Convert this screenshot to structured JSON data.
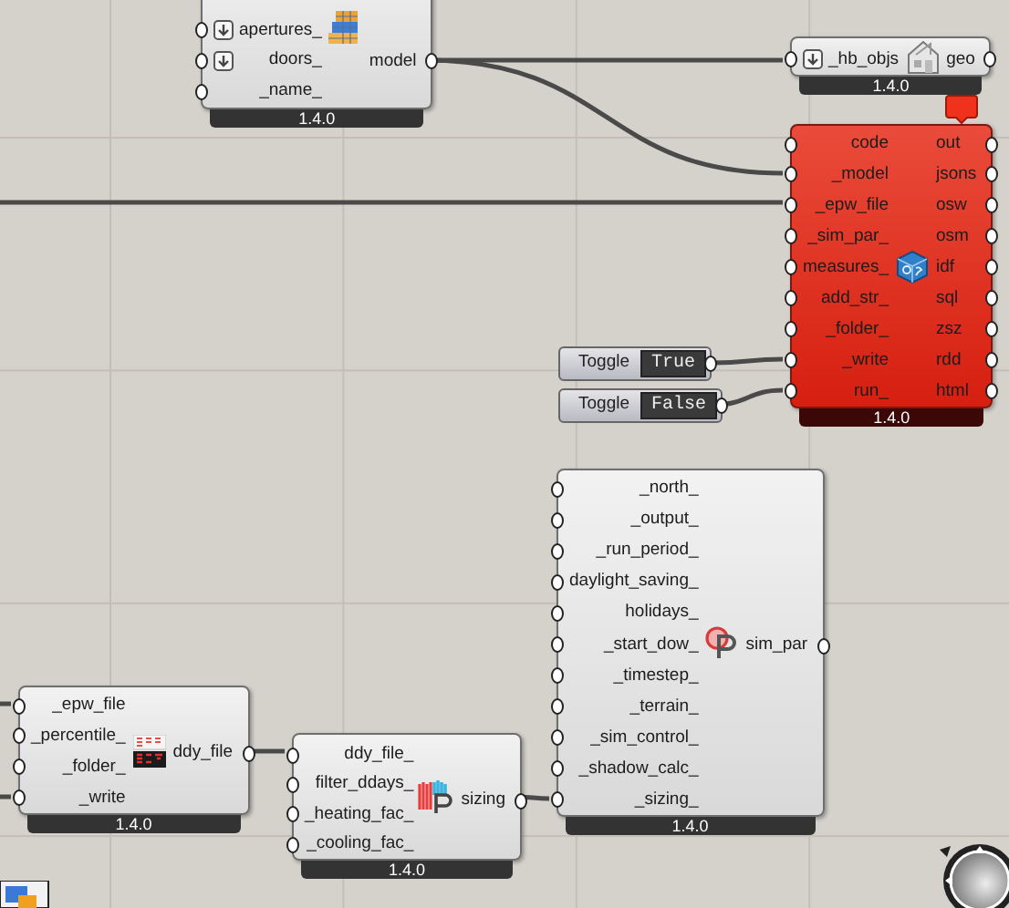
{
  "components": [
    {
      "kind": "model",
      "error": false,
      "inputs": [
        {
          "label": "apertures_",
          "arrow": true
        },
        {
          "label": "doors_",
          "arrow": true
        },
        {
          "label": "_name_",
          "arrow": false
        }
      ],
      "outputs": [
        {
          "label": "model"
        }
      ],
      "version": "1.4.0"
    },
    {
      "kind": "deconstruct",
      "error": false,
      "inputs": [
        {
          "label": "_hb_objs",
          "arrow": true
        }
      ],
      "outputs": [
        {
          "label": "geo"
        }
      ],
      "version": "1.4.0"
    },
    {
      "kind": "run_osm",
      "error": true,
      "inputs": [
        {
          "label": "code",
          "arrow": false
        },
        {
          "label": "_model",
          "arrow": false
        },
        {
          "label": "_epw_file",
          "arrow": false
        },
        {
          "label": "_sim_par_",
          "arrow": false
        },
        {
          "label": "measures_",
          "arrow": false
        },
        {
          "label": "add_str_",
          "arrow": false
        },
        {
          "label": "_folder_",
          "arrow": false
        },
        {
          "label": "_write",
          "arrow": false
        },
        {
          "label": "run_",
          "arrow": false
        }
      ],
      "outputs": [
        {
          "label": "out"
        },
        {
          "label": "jsons"
        },
        {
          "label": "osw"
        },
        {
          "label": "osm"
        },
        {
          "label": "idf"
        },
        {
          "label": "sql"
        },
        {
          "label": "zsz"
        },
        {
          "label": "rdd"
        },
        {
          "label": "html"
        }
      ],
      "version": "1.4.0"
    },
    {
      "kind": "ddy",
      "error": false,
      "inputs": [
        {
          "label": "_epw_file",
          "arrow": false
        },
        {
          "label": "_percentile_",
          "arrow": false
        },
        {
          "label": "_folder_",
          "arrow": false
        },
        {
          "label": "_write",
          "arrow": false
        }
      ],
      "outputs": [
        {
          "label": "ddy_file"
        }
      ],
      "version": "1.4.0"
    },
    {
      "kind": "sizing",
      "error": false,
      "inputs": [
        {
          "label": "ddy_file_",
          "arrow": false
        },
        {
          "label": "filter_ddays_",
          "arrow": false
        },
        {
          "label": "_heating_fac_",
          "arrow": false
        },
        {
          "label": "_cooling_fac_",
          "arrow": false
        }
      ],
      "outputs": [
        {
          "label": "sizing"
        }
      ],
      "version": "1.4.0"
    },
    {
      "kind": "sim_par",
      "error": false,
      "inputs": [
        {
          "label": "_north_",
          "arrow": false
        },
        {
          "label": "_output_",
          "arrow": false
        },
        {
          "label": "_run_period_",
          "arrow": false
        },
        {
          "label": "daylight_saving_",
          "arrow": false
        },
        {
          "label": "holidays_",
          "arrow": false
        },
        {
          "label": "_start_dow_",
          "arrow": false
        },
        {
          "label": "_timestep_",
          "arrow": false
        },
        {
          "label": "_terrain_",
          "arrow": false
        },
        {
          "label": "_sim_control_",
          "arrow": false
        },
        {
          "label": "_shadow_calc_",
          "arrow": false
        },
        {
          "label": "_sizing_",
          "arrow": false
        }
      ],
      "outputs": [
        {
          "label": "sim_par"
        }
      ],
      "version": "1.4.0"
    }
  ],
  "toggles": [
    {
      "label": "Toggle",
      "value": "True"
    },
    {
      "label": "Toggle",
      "value": "False"
    }
  ]
}
